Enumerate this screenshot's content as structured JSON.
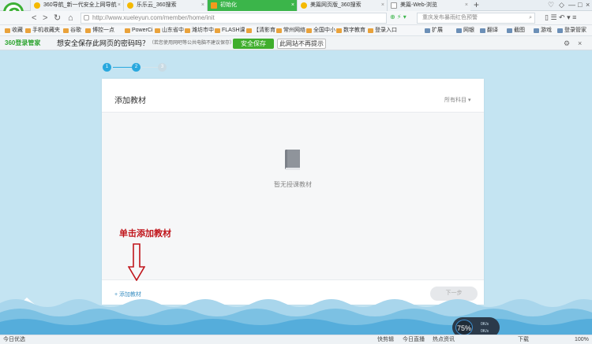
{
  "browser": {
    "tabs": [
      {
        "label": "360导航_新一代安全上网导航"
      },
      {
        "label": "乐乐云_360搜索"
      },
      {
        "label": "初始化"
      },
      {
        "label": "美篇网页版_360搜索"
      },
      {
        "label": "美篇-Web-浏览"
      }
    ],
    "new_tab": "+",
    "address": {
      "url": "http://www.xueleyun.com/member/home/init"
    },
    "search": {
      "placeholder": "重庆发布暴雨红色预警"
    },
    "bookmarks": [
      "收藏",
      "手机收藏夹",
      "谷歌",
      "博控一点",
      "PowerCi",
      "山东省中",
      "潍坊市中",
      "FLASH课",
      "【清影育",
      "常州网络",
      "全国中小",
      "数字教育",
      "登录入口"
    ],
    "bookmarks_right": [
      "扩展",
      "网银",
      "翻译",
      "截图",
      "游戏",
      "登录管家"
    ]
  },
  "save_password_bar": {
    "brand": "360登录管家",
    "question": "想安全保存此网页的密码吗？",
    "note": "（若您使用网吧等公共电脑不建议保存）",
    "save_button": "安全保存",
    "never_button": "此网站不再提示"
  },
  "wizard": {
    "steps": [
      "1",
      "2",
      "3"
    ],
    "current_step": 2,
    "card_title": "添加教材",
    "subject_filter": "所有科目",
    "empty_message": "暂无授课教材",
    "add_link": "+ 添加教材",
    "next_button": "下一步"
  },
  "annotation": {
    "text": "单击添加教材",
    "color": "#c0151b"
  },
  "statusbar": {
    "left": "今日优选",
    "items": [
      "快剪辑",
      "今日直播",
      "热点资讯",
      "下载",
      "100%"
    ],
    "speed_percent": "75%",
    "up_rate": "0K/s",
    "down_rate": "0K/s"
  },
  "colors": {
    "page_background": "#c4e4f2",
    "step_active": "#29a8de",
    "accent_green": "#3fae2c"
  }
}
